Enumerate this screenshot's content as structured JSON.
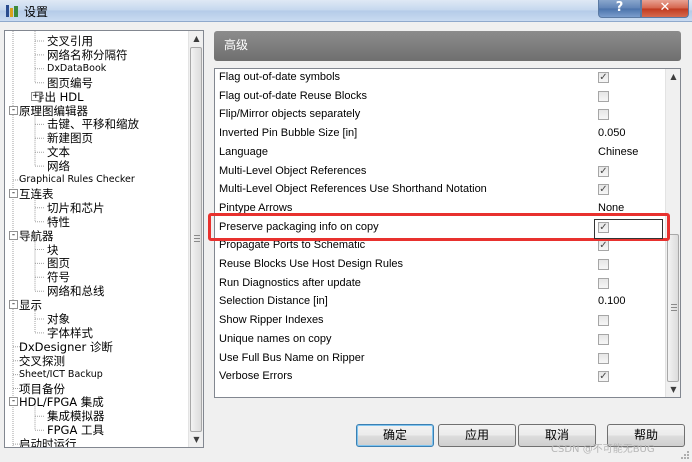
{
  "window": {
    "title": "设置",
    "help_label": "?",
    "close_label": "✕"
  },
  "tree": {
    "items": [
      {
        "label": "交叉引用",
        "level": 2
      },
      {
        "label": "网络名称分隔符",
        "level": 2
      },
      {
        "label": "DxDataBook",
        "level": 2
      },
      {
        "label": "图页编号",
        "level": 2
      },
      {
        "label": "导出 HDL",
        "level": 1,
        "expander": "+"
      },
      {
        "label": "原理图编辑器",
        "level": 0,
        "expander": "-"
      },
      {
        "label": "击键、平移和缩放",
        "level": 2
      },
      {
        "label": "新建图页",
        "level": 2
      },
      {
        "label": "文本",
        "level": 2
      },
      {
        "label": "网络",
        "level": 2
      },
      {
        "label": "Graphical Rules Checker",
        "level": 0
      },
      {
        "label": "互连表",
        "level": 0,
        "expander": "-"
      },
      {
        "label": "切片和芯片",
        "level": 2
      },
      {
        "label": "特性",
        "level": 2
      },
      {
        "label": "导航器",
        "level": 0,
        "expander": "-"
      },
      {
        "label": "块",
        "level": 2
      },
      {
        "label": "图页",
        "level": 2
      },
      {
        "label": "符号",
        "level": 2
      },
      {
        "label": "网络和总线",
        "level": 2
      },
      {
        "label": "显示",
        "level": 0,
        "expander": "-"
      },
      {
        "label": "对象",
        "level": 2
      },
      {
        "label": "字体样式",
        "level": 2
      },
      {
        "label": "DxDesigner 诊断",
        "level": 0
      },
      {
        "label": "交叉探测",
        "level": 0
      },
      {
        "label": "Sheet/ICT Backup",
        "level": 0
      },
      {
        "label": "项目备份",
        "level": 0
      },
      {
        "label": "HDL/FPGA 集成",
        "level": 0,
        "expander": "-"
      },
      {
        "label": "集成模拟器",
        "level": 2
      },
      {
        "label": "FPGA 工具",
        "level": 2
      },
      {
        "label": "启动时运行",
        "level": 0
      }
    ]
  },
  "section": {
    "title": "高级"
  },
  "properties": [
    {
      "label": "Flag out-of-date symbols",
      "type": "checkbox",
      "checked": true
    },
    {
      "label": "Flag out-of-date Reuse Blocks",
      "type": "checkbox",
      "checked": false
    },
    {
      "label": "Flip/Mirror objects separately",
      "type": "checkbox",
      "checked": false
    },
    {
      "label": "Inverted Pin Bubble Size [in]",
      "type": "text",
      "value": "0.050"
    },
    {
      "label": "Language",
      "type": "text",
      "value": "Chinese"
    },
    {
      "label": "Multi-Level Object References",
      "type": "checkbox",
      "checked": true
    },
    {
      "label": "Multi-Level Object References Use Shorthand Notation",
      "type": "checkbox",
      "checked": true
    },
    {
      "label": "Pintype Arrows",
      "type": "text",
      "value": "None"
    },
    {
      "label": "Preserve packaging info on copy",
      "type": "checkbox",
      "checked": true
    },
    {
      "label": "Propagate Ports to Schematic",
      "type": "checkbox",
      "checked": true
    },
    {
      "label": "Reuse Blocks Use Host Design Rules",
      "type": "checkbox",
      "checked": false
    },
    {
      "label": "Run Diagnostics after update",
      "type": "checkbox",
      "checked": false
    },
    {
      "label": "Selection Distance [in]",
      "type": "text",
      "value": "0.100"
    },
    {
      "label": "Show Ripper Indexes",
      "type": "checkbox",
      "checked": false
    },
    {
      "label": "Unique names on copy",
      "type": "checkbox",
      "checked": false
    },
    {
      "label": "Use Full Bus Name on Ripper",
      "type": "checkbox",
      "checked": false
    },
    {
      "label": "Verbose Errors",
      "type": "checkbox",
      "checked": true
    }
  ],
  "buttons": {
    "ok": "确定",
    "apply": "应用",
    "cancel": "取消",
    "help": "帮助"
  },
  "watermark": "CSDN @不可能无BUG",
  "colors": {
    "highlight": "#e8312e",
    "section_header": "#7d7d7d"
  }
}
